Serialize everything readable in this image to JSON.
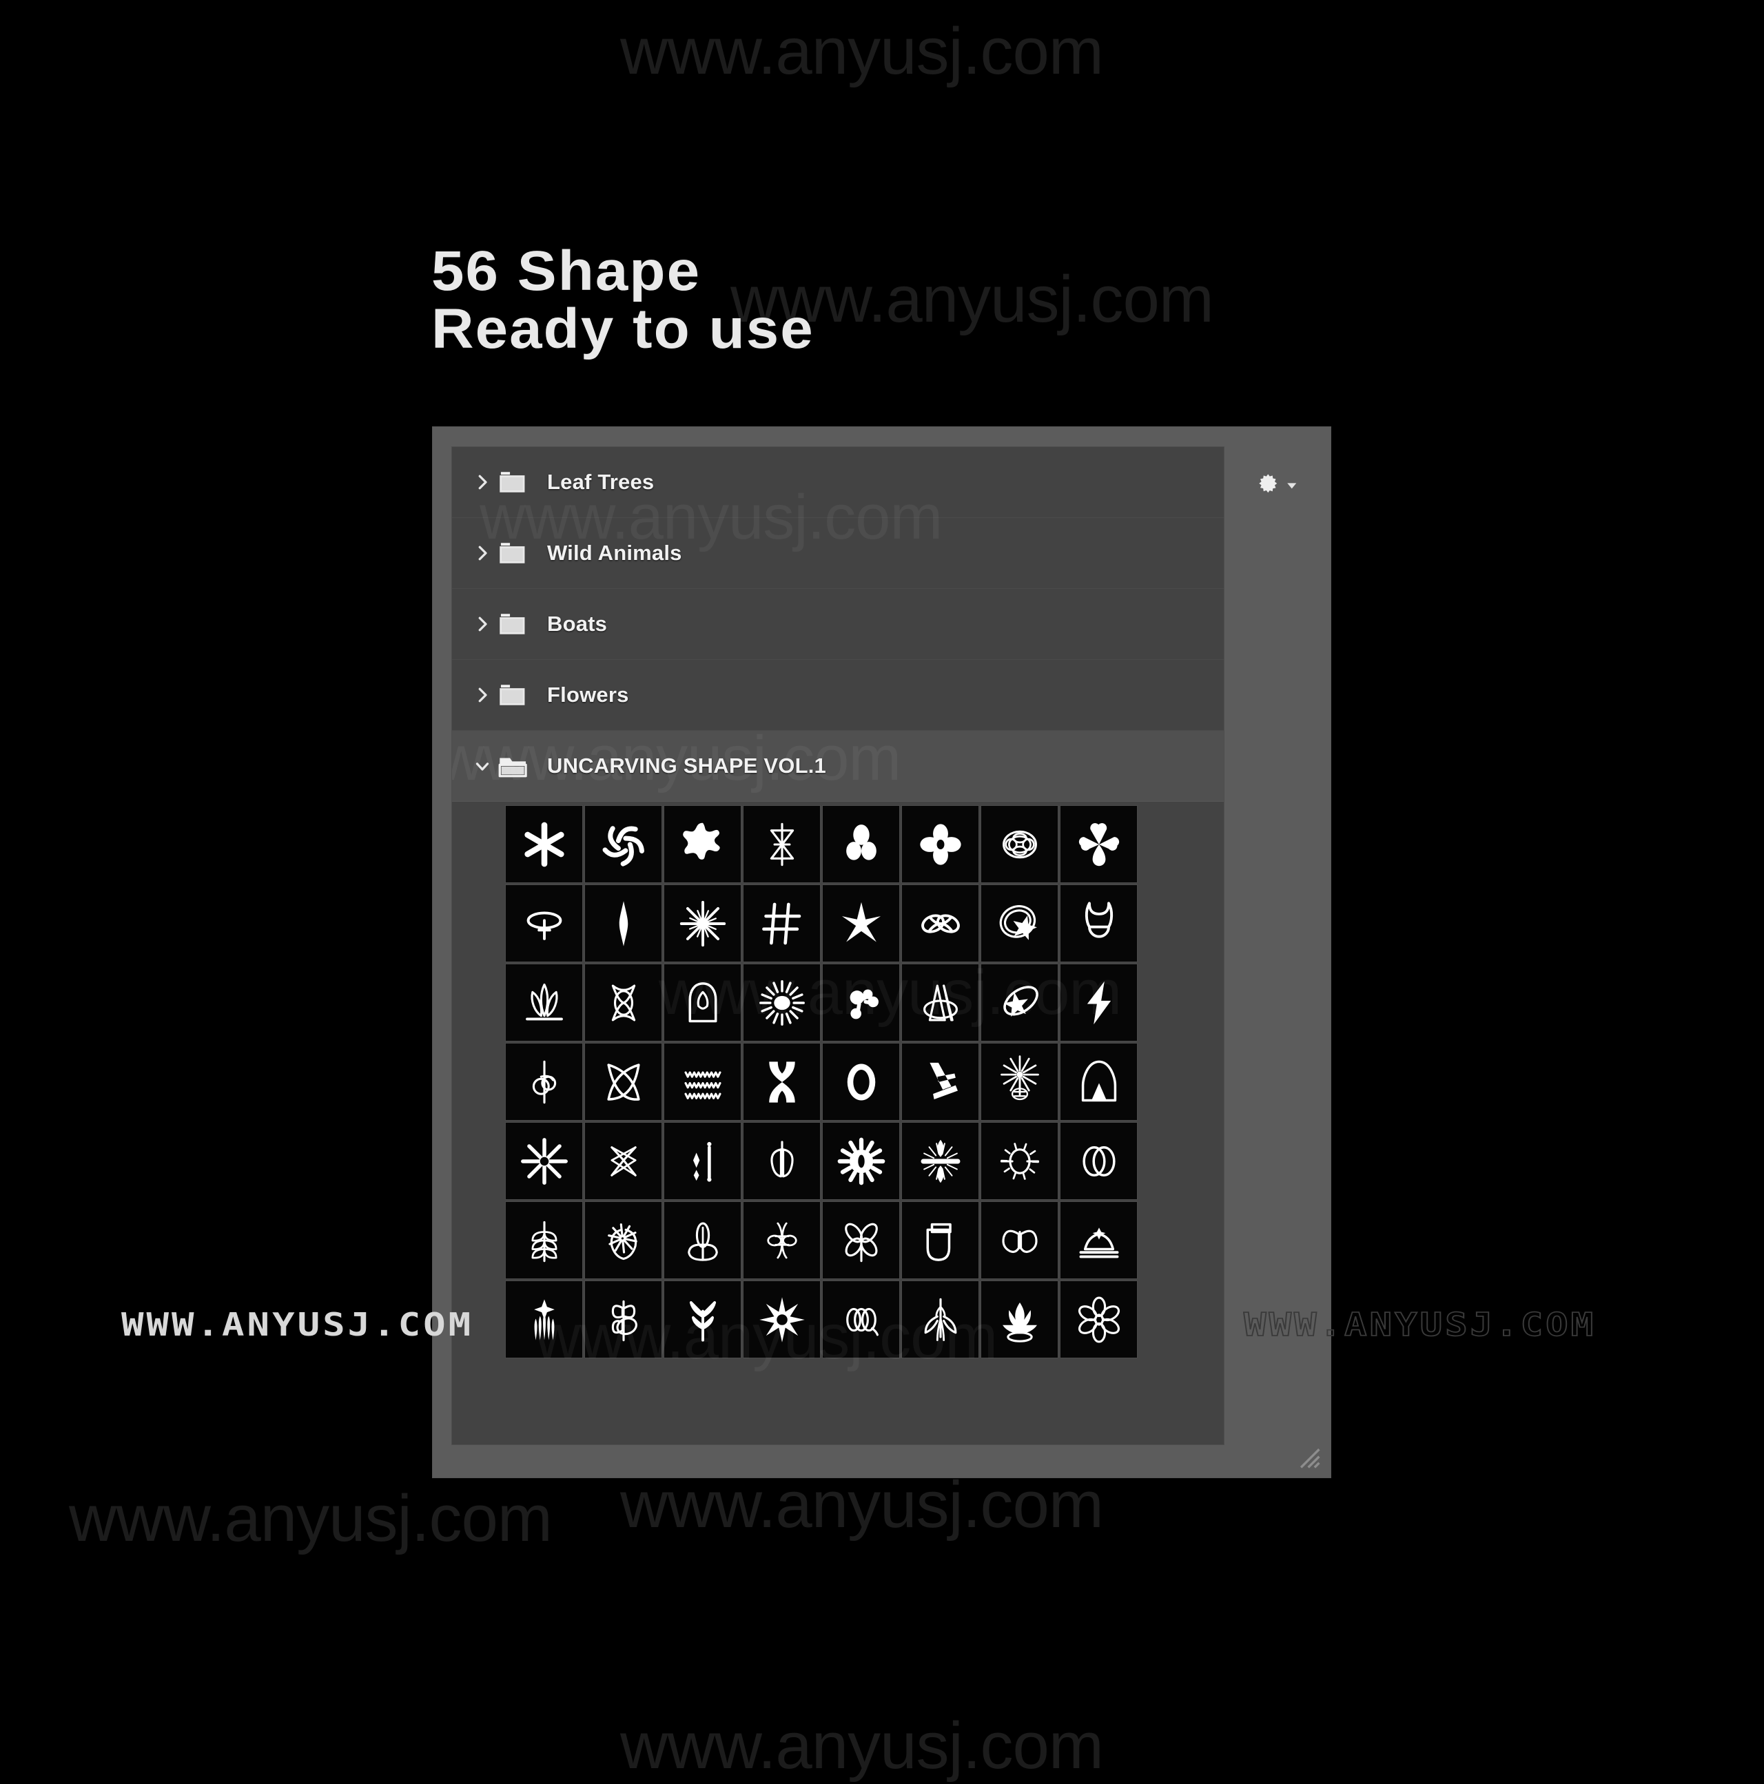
{
  "headline": {
    "line1": "56 Shape",
    "line2": "Ready to use",
    "full": "56 Shape\nReady to use"
  },
  "panel": {
    "gear_icon": "gear-icon",
    "gear_caret_icon": "chevron-down-icon",
    "resize_grip_icon": "resize-grip-icon",
    "colors": {
      "panel_frame": "#5c5c5c",
      "list_background": "#434343",
      "row_divider": "#4b4b4b",
      "selected_row": "#505050",
      "cell_background": "#060606",
      "shape_stroke": "#ffffff",
      "label_text": "#f2f2f2"
    },
    "folders": [
      {
        "label": "Leaf Trees",
        "expanded": false,
        "twisty_icon": "chevron-right-icon",
        "folder_icon": "folder-closed-icon"
      },
      {
        "label": "Wild Animals",
        "expanded": false,
        "twisty_icon": "chevron-right-icon",
        "folder_icon": "folder-closed-icon"
      },
      {
        "label": "Boats",
        "expanded": false,
        "twisty_icon": "chevron-right-icon",
        "folder_icon": "folder-closed-icon"
      },
      {
        "label": "Flowers",
        "expanded": false,
        "twisty_icon": "chevron-right-icon",
        "folder_icon": "folder-closed-icon"
      },
      {
        "label": "UNCARVING SHAPE VOL.1",
        "expanded": true,
        "twisty_icon": "chevron-down-icon",
        "folder_icon": "folder-open-icon"
      }
    ],
    "grid": {
      "columns": 8,
      "rows": 7,
      "count": 56,
      "shapes": [
        "six-point-asterisk-star",
        "pinwheel-swirl-spiral",
        "splash-blob-starfish",
        "hourglass-arrow-glyph",
        "three-petal-clover",
        "four-petal-flower-ring",
        "layered-oval-rosette",
        "four-drop-cross-bloom",
        "oval-ring-with-spark",
        "vertical-lens-spindle",
        "eight-ray-sparkle-burst",
        "hash-sparkle-grid",
        "five-point-shard-star",
        "double-loop-infinity-knot",
        "spiral-orbit-with-star",
        "tulip-bud-outline",
        "three-leaf-sprout-base",
        "fish-eye-vesica-knot",
        "seed-pod-droplet-dome",
        "radiant-sun-rays",
        "molecule-cluster-blob",
        "layered-sail-arcs",
        "star-in-ellipse-orbit",
        "lightning-bolt",
        "key-ring-vertical-stem",
        "bowtie-lens-curve",
        "triple-zigzag-waves",
        "hourglass-butterfly-solid",
        "oval-ring-thick",
        "three-stroke-blades",
        "starburst-seedhead",
        "dome-arch-with-cone",
        "eight-ray-star-center-dot",
        "woven-diamond-lattice",
        "spark-exclamation-pair",
        "leaf-pair-shield",
        "sun-with-eye-center",
        "spindle-cross-feather",
        "beetle-sun-outline",
        "double-oval-rings",
        "wheat-leaf-stalk",
        "starburst-on-leaf",
        "lotus-bud-outline",
        "braided-insect-glyph",
        "four-petal-dragonfly",
        "folded-shield-tag",
        "butterfly-outline",
        "crown-on-base",
        "lotus-flame-bloom",
        "pinwheel-leaf-stem",
        "wheat-sprig-sprout",
        "eight-point-gear-star",
        "triple-interlocked-loops",
        "insect-antenna-spray",
        "flame-crown-blossom",
        "six-petal-daisy"
      ]
    }
  },
  "watermarks": {
    "bottom_left": "WWW.ANYUSJ.COM",
    "bottom_right": "WWW.ANYUSJ.COM",
    "background_tile": "www.anyusj.com"
  }
}
